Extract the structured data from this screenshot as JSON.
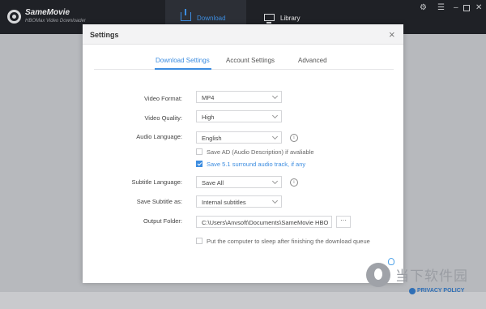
{
  "app": {
    "name": "SameMovie",
    "subtitle": "HBOMax Video Downloader"
  },
  "nav": {
    "download": "Download",
    "library": "Library"
  },
  "dialog": {
    "title": "Settings",
    "close": "×",
    "tabs": [
      "Download Settings",
      "Account Settings",
      "Advanced"
    ],
    "active_tab": "Download Settings"
  },
  "settings": {
    "video_format": {
      "label": "Video Format:",
      "value": "MP4"
    },
    "video_quality": {
      "label": "Video Quality:",
      "value": "High"
    },
    "audio_language": {
      "label": "Audio Language:",
      "value": "English"
    },
    "save_ad": {
      "label": "Save AD (Audio Description) if avaliable",
      "checked": false
    },
    "save_51": {
      "label": "Save 5.1 surround audio track, if any",
      "checked": true
    },
    "subtitle_language": {
      "label": "Subtitle Language:",
      "value": "Save All"
    },
    "save_subtitle_as": {
      "label": "Save Subtitle as:",
      "value": "Internal subtitles"
    },
    "output_folder": {
      "label": "Output Folder:",
      "value": "C:\\Users\\Anvsoft\\Documents\\SameMovie HBO",
      "browse": "···"
    },
    "sleep": {
      "label": "Put the computer to sleep after finishing the download queue",
      "checked": false
    }
  },
  "footer": {
    "privacy": "PRIVACY POLICY",
    "watermark": "当下软件园"
  },
  "colors": {
    "accent": "#3d8de0",
    "titlebar": "#1f2126"
  }
}
